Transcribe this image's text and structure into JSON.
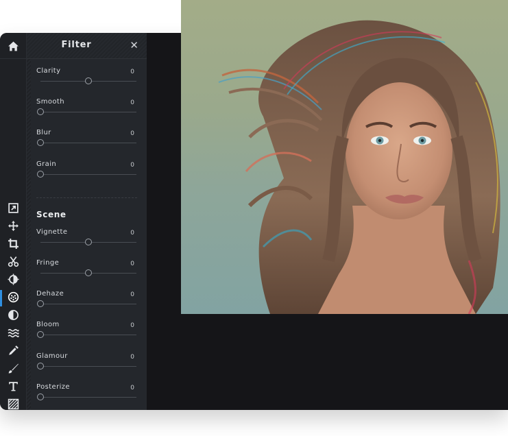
{
  "toolbar": {
    "tools": [
      {
        "name": "home-icon"
      },
      {
        "name": "export-icon"
      },
      {
        "name": "move-icon"
      },
      {
        "name": "crop-icon"
      },
      {
        "name": "cut-icon"
      },
      {
        "name": "adjust-icon"
      },
      {
        "name": "filter-icon",
        "active": true
      },
      {
        "name": "effect-icon"
      },
      {
        "name": "wave-icon"
      },
      {
        "name": "eyedropper-icon"
      },
      {
        "name": "brush-icon"
      },
      {
        "name": "text-icon"
      },
      {
        "name": "texture-icon"
      },
      {
        "name": "image-icon"
      }
    ]
  },
  "panel": {
    "title": "Filter",
    "close_label": "✕",
    "scene_title": "Scene",
    "sliders": [
      {
        "label": "Clarity",
        "value": "0",
        "position": 0.5
      },
      {
        "label": "Smooth",
        "value": "0",
        "position": 0.0
      },
      {
        "label": "Blur",
        "value": "0",
        "position": 0.0
      },
      {
        "label": "Grain",
        "value": "0",
        "position": 0.0
      }
    ],
    "scene_sliders": [
      {
        "label": "Vignette",
        "value": "0",
        "position": 0.5
      },
      {
        "label": "Fringe",
        "value": "0",
        "position": 0.5
      },
      {
        "label": "Dehaze",
        "value": "0",
        "position": 0.0
      },
      {
        "label": "Bloom",
        "value": "0",
        "position": 0.0
      },
      {
        "label": "Glamour",
        "value": "0",
        "position": 0.0
      },
      {
        "label": "Posterize",
        "value": "0",
        "position": 0.0
      }
    ]
  },
  "colors": {
    "accent": "#2f8fe0",
    "panel_bg": "#24272c",
    "workspace_bg": "#151518"
  }
}
